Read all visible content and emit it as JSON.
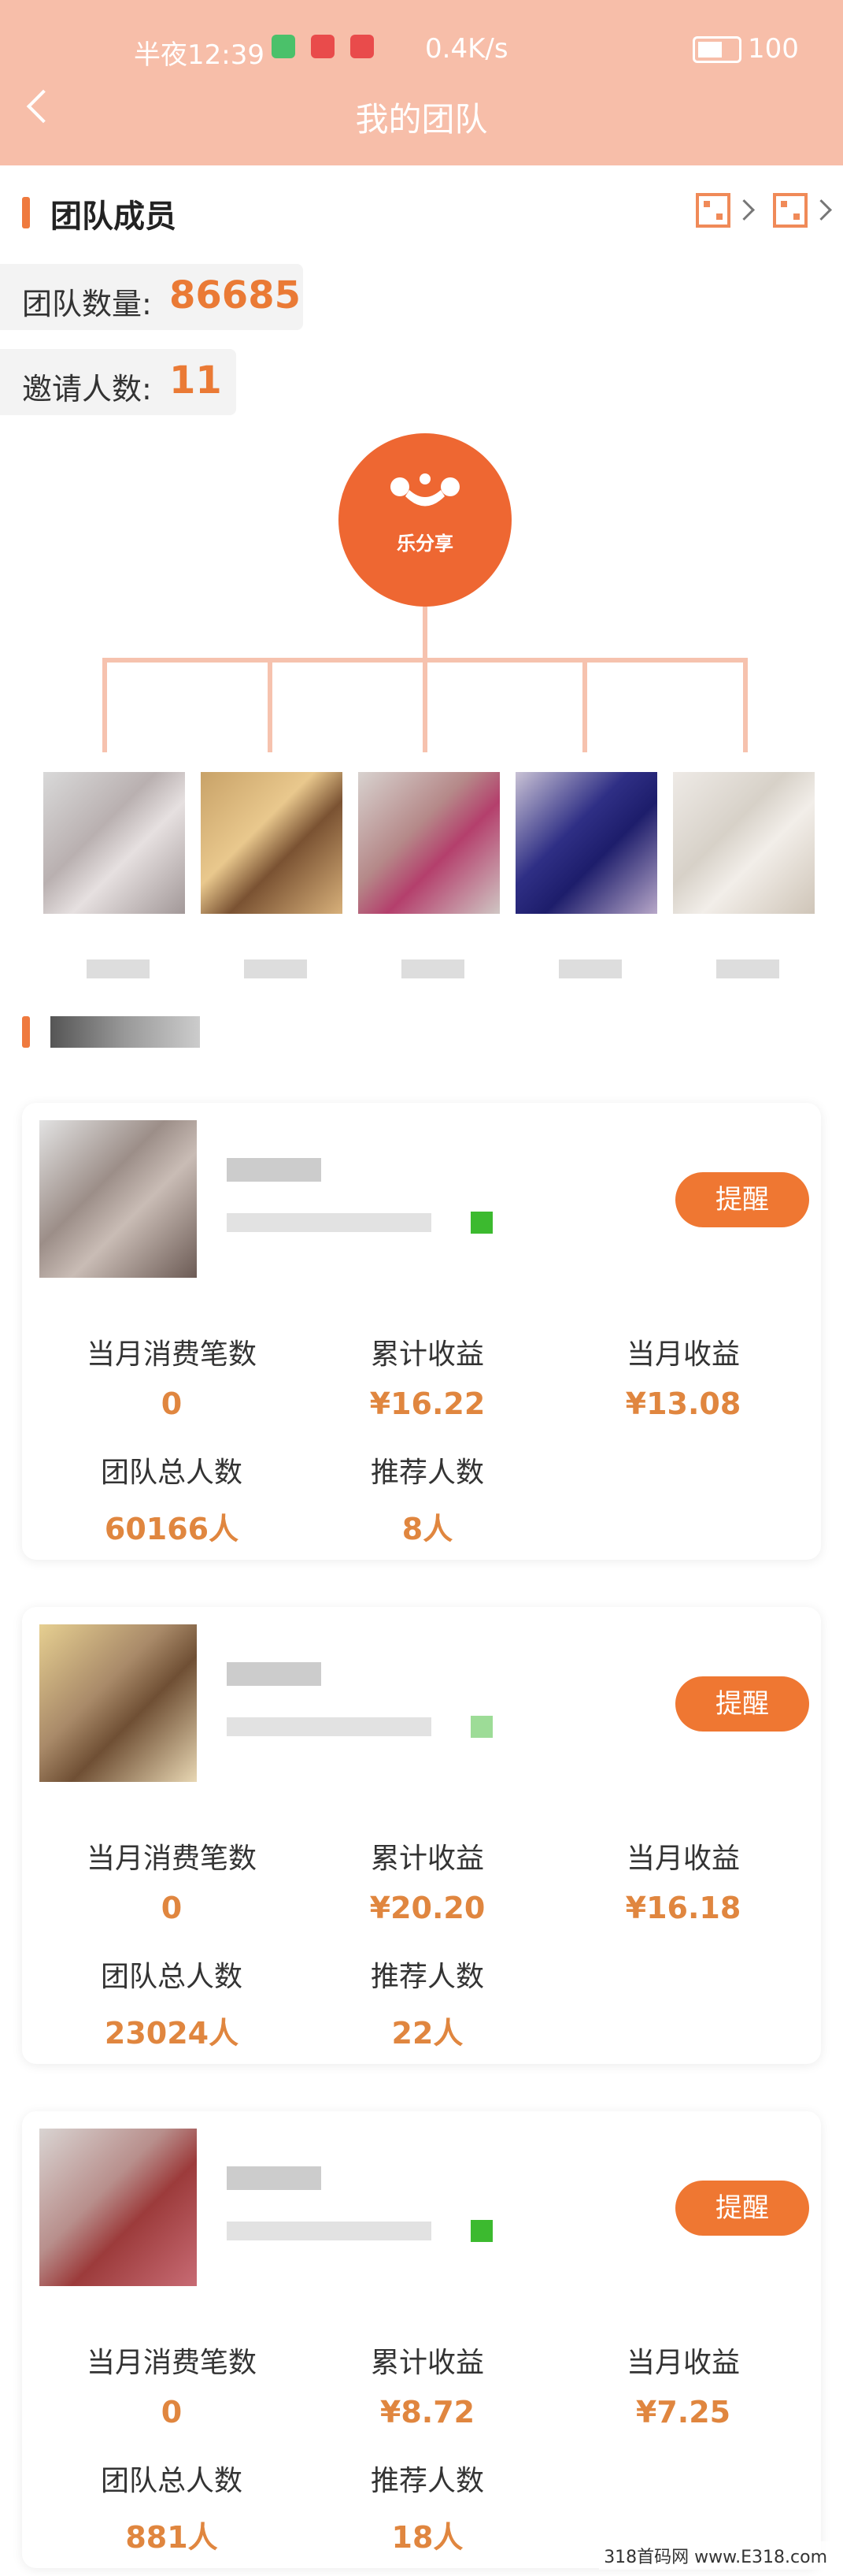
{
  "status": {
    "time": "半夜12:39",
    "speed": "0.4K/s",
    "battery": "100"
  },
  "header": {
    "title": "我的团队"
  },
  "members_section": {
    "title": "团队成员",
    "team_count_label": "团队数量:",
    "team_count": "86685",
    "invite_label": "邀请人数:",
    "invite_count": "11"
  },
  "logo": {
    "name": "乐分享"
  },
  "cards": [
    {
      "button": "提醒",
      "k1": "当月消费笔数",
      "v1": "0",
      "k2": "累计收益",
      "v2": "¥16.22",
      "k3": "当月收益",
      "v3": "¥13.08",
      "k4": "团队总人数",
      "v4": "60166人",
      "k5": "推荐人数",
      "v5": "8人"
    },
    {
      "button": "提醒",
      "k1": "当月消费笔数",
      "v1": "0",
      "k2": "累计收益",
      "v2": "¥20.20",
      "k3": "当月收益",
      "v3": "¥16.18",
      "k4": "团队总人数",
      "v4": "23024人",
      "k5": "推荐人数",
      "v5": "22人"
    },
    {
      "button": "提醒",
      "k1": "当月消费笔数",
      "v1": "0",
      "k2": "累计收益",
      "v2": "¥8.72",
      "k3": "当月收益",
      "v3": "¥7.25",
      "k4": "团队总人数",
      "v4": "881人",
      "k5": "推荐人数",
      "v5": "18人"
    }
  ],
  "watermark": "318首码网 www.E318.com",
  "colors": {
    "accent": "#ef7732",
    "header": "#f7bea9",
    "value": "#e0863f"
  }
}
